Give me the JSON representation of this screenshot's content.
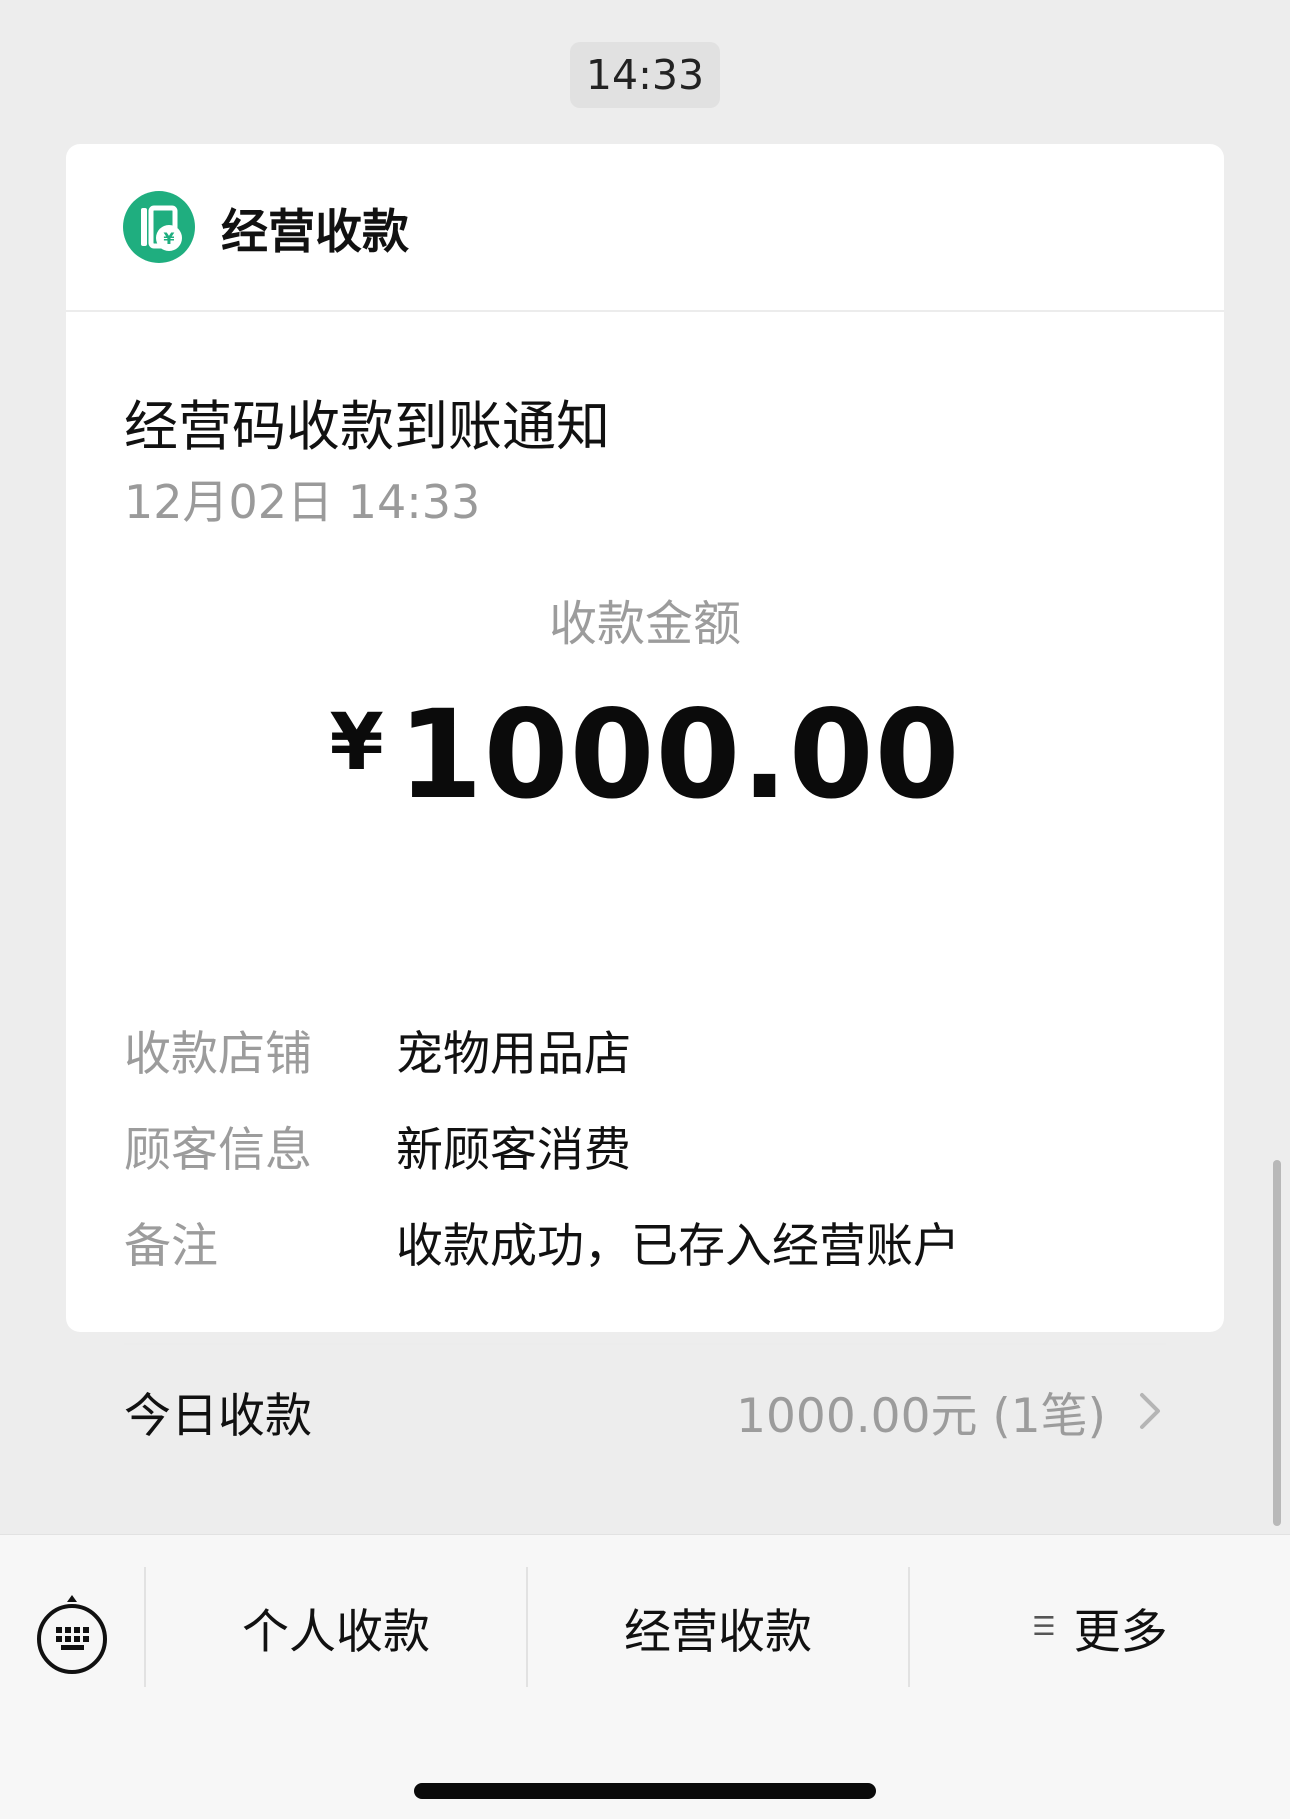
{
  "chat": {
    "timestamp": "14:33"
  },
  "card": {
    "app_name": "经营收款",
    "logo_icon": "merchant-receipt-icon",
    "title": "经营码收款到账通知",
    "datetime": "12月02日 14:33",
    "amount_label": "收款金额",
    "currency_symbol": "¥",
    "amount": "1000.00",
    "details": [
      {
        "label": "收款店铺",
        "value": "宠物用品店"
      },
      {
        "label": "顾客信息",
        "value": "新顾客消费"
      },
      {
        "label": "备注",
        "value": "收款成功，已存入经营账户"
      }
    ],
    "today": {
      "label": "今日收款",
      "value": "1000.00元 (1笔)"
    }
  },
  "bottom_menu": {
    "keyboard_icon": "keyboard-icon",
    "items": [
      {
        "label": "个人收款"
      },
      {
        "label": "经营收款"
      },
      {
        "label": "更多",
        "icon": "menu-lines-icon"
      }
    ]
  },
  "colors": {
    "background": "#ededed",
    "card": "#ffffff",
    "accent": "#1fae7f",
    "secondary_text": "#9c9c9c"
  }
}
